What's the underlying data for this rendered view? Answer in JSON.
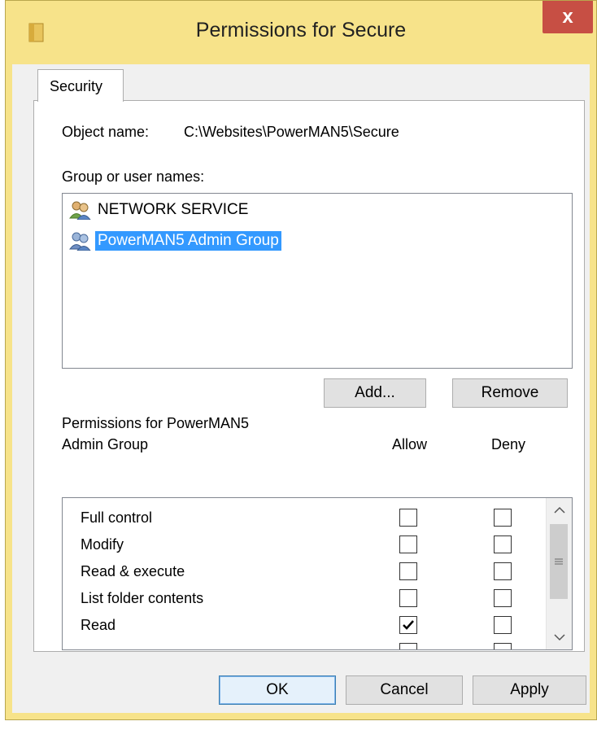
{
  "window": {
    "title": "Permissions for Secure",
    "close_glyph": "x",
    "icon": "folder-icon"
  },
  "tabs": [
    {
      "label": "Security",
      "active": true
    }
  ],
  "security": {
    "object_name_label": "Object name:",
    "object_name_value": "C:\\Websites\\PowerMAN5\\Secure",
    "group_label": "Group or user names:",
    "principals": [
      {
        "name": "NETWORK SERVICE",
        "icon": "user-group-icon",
        "selected": false
      },
      {
        "name": "PowerMAN5 Admin Group",
        "icon": "user-group-icon",
        "selected": true
      }
    ],
    "add_button": "Add...",
    "remove_button": "Remove",
    "permissions_label_line1": "Permissions for PowerMAN5",
    "permissions_label_line2": "Admin Group",
    "allow_header": "Allow",
    "deny_header": "Deny",
    "permissions": [
      {
        "name": "Full control",
        "allow": false,
        "deny": false
      },
      {
        "name": "Modify",
        "allow": false,
        "deny": false
      },
      {
        "name": "Read & execute",
        "allow": false,
        "deny": false
      },
      {
        "name": "List folder contents",
        "allow": false,
        "deny": false
      },
      {
        "name": "Read",
        "allow": true,
        "deny": false
      }
    ]
  },
  "footer": {
    "ok_button": "OK",
    "cancel_button": "Cancel",
    "apply_button": "Apply"
  },
  "colors": {
    "titlebar": "#f7e38a",
    "close": "#c74f44",
    "selection": "#3399ff"
  }
}
